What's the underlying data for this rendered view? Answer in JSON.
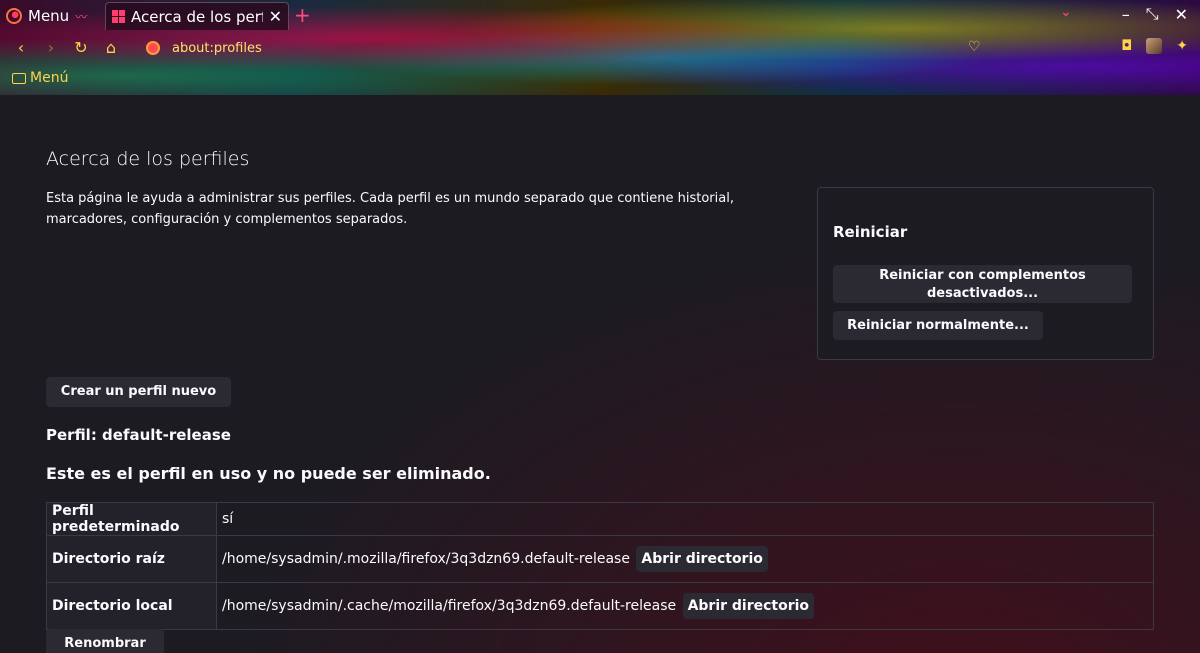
{
  "browser": {
    "menu_label": "Menu",
    "tab_title": "Acerca de los perfiles",
    "url": "about:profiles",
    "bookmark_folder": "Menú",
    "accent_color": "#ffd24a"
  },
  "page": {
    "title": "Acerca de los perfiles",
    "intro": "Esta página le ayuda a administrar sus perfiles. Cada perfil es un mundo separado que contiene historial, marcadores, configuración y complementos separados.",
    "restart": {
      "title": "Reiniciar",
      "safe_mode_button": "Reiniciar con complementos desactivados...",
      "normal_button": "Reiniciar normalmente..."
    },
    "create_button": "Crear un perfil nuevo",
    "profile": {
      "heading": "Perfil: default-release",
      "in_use_notice": "Este es el perfil en uso y no puede ser eliminado.",
      "rows": [
        {
          "key": "Perfil predeterminado",
          "value": "sí"
        },
        {
          "key": "Directorio raíz",
          "value": "/home/sysadmin/.mozilla/firefox/3q3dzn69.default-release",
          "button": "Abrir directorio"
        },
        {
          "key": "Directorio local",
          "value": "/home/sysadmin/.cache/mozilla/firefox/3q3dzn69.default-release",
          "button": "Abrir directorio"
        }
      ],
      "rename_button": "Renombrar"
    }
  }
}
